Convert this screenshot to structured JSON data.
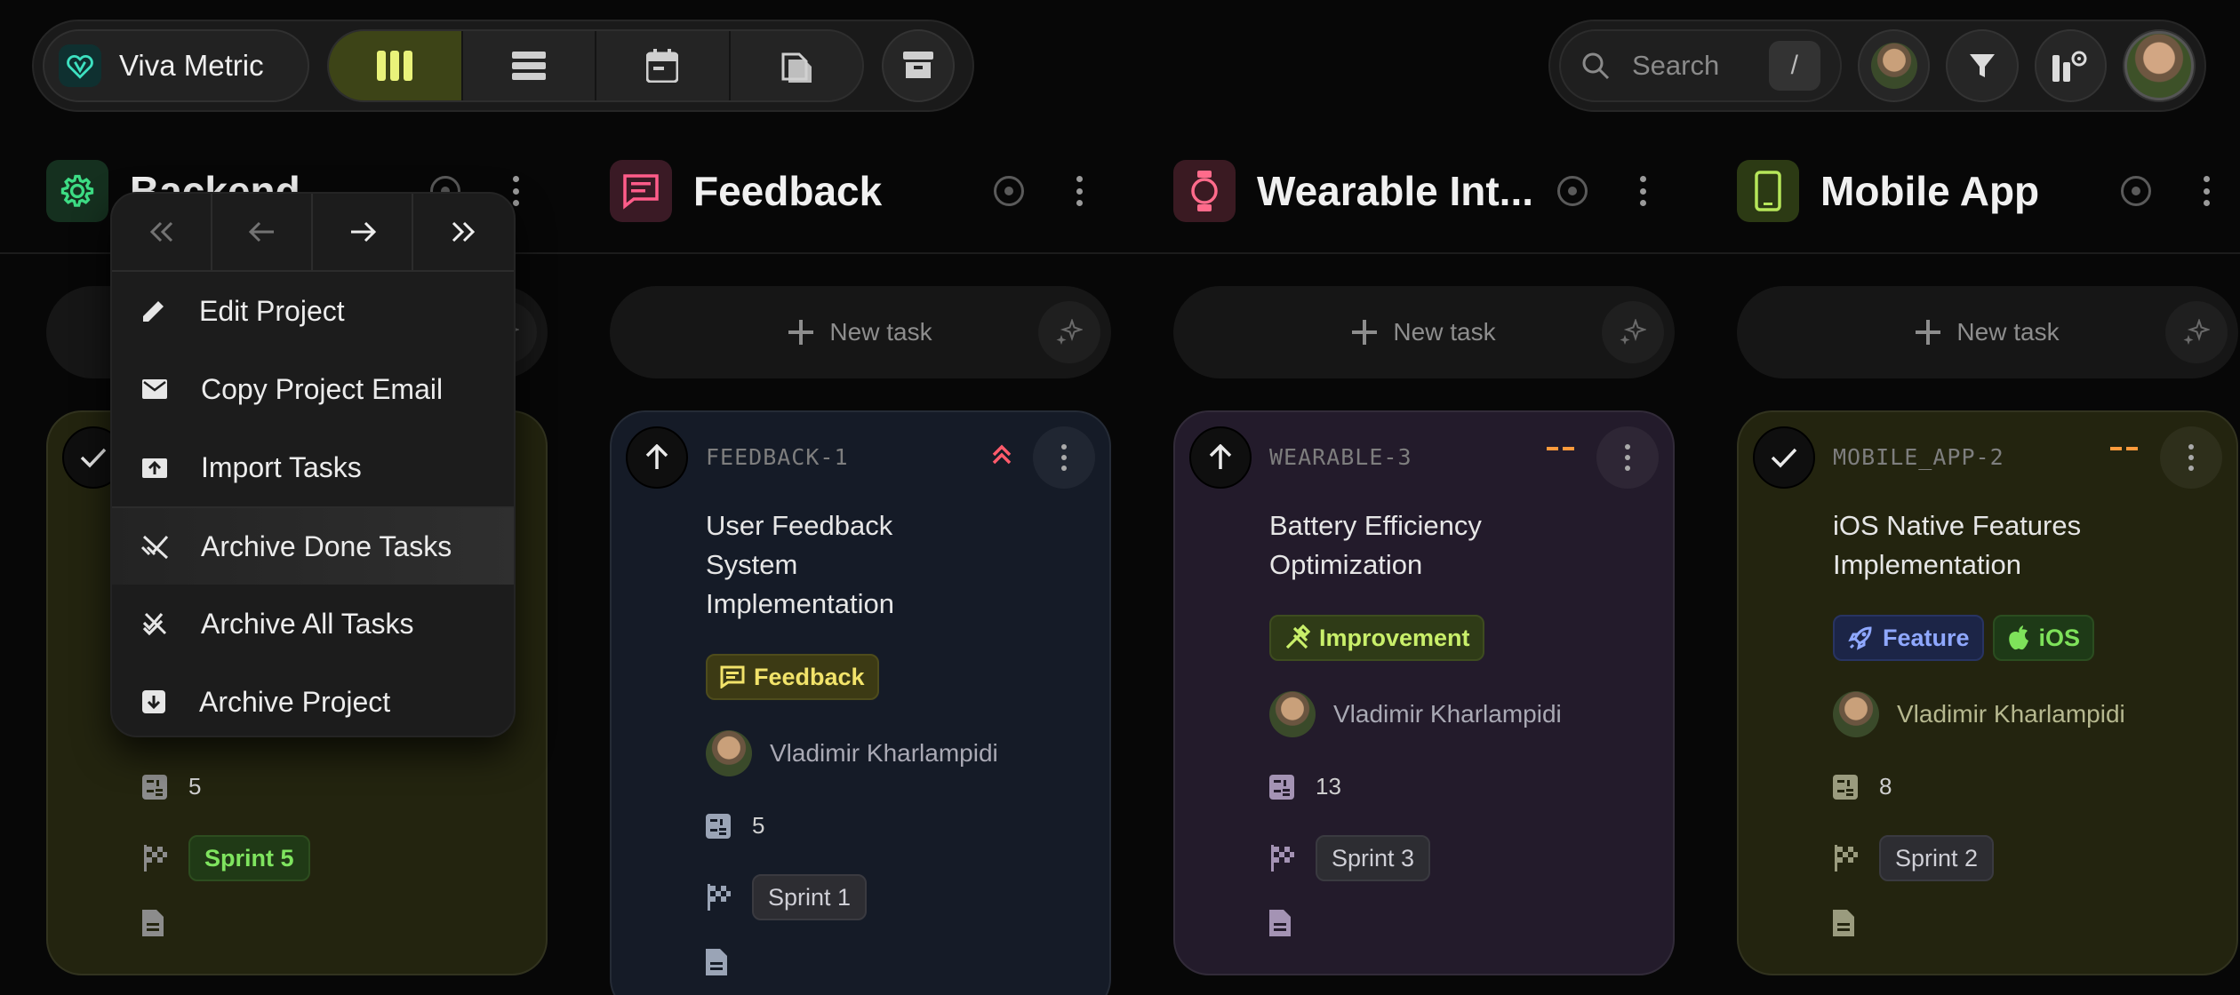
{
  "brand": {
    "name": "Viva Metric"
  },
  "search": {
    "placeholder": "Search",
    "shortcut": "/"
  },
  "columns": [
    {
      "title": "Backend",
      "icon": "gear-icon",
      "accent": "#3ddc84"
    },
    {
      "title": "Feedback",
      "icon": "comment-icon",
      "accent": "#ff5c8a"
    },
    {
      "title": "Wearable Int...",
      "icon": "watch-icon",
      "accent": "#ff6b8b"
    },
    {
      "title": "Mobile App",
      "icon": "smartphone-icon",
      "accent": "#b6e65a"
    }
  ],
  "new_task_label": "New task",
  "cards": [
    {
      "estimate": "5",
      "sprint": "Sprint 5"
    },
    {
      "id": "FEEDBACK-1",
      "title": "User Feedback System Implementation",
      "tags": [
        "Feedback"
      ],
      "assignee": "Vladimir Kharlampidi",
      "estimate": "5",
      "sprint": "Sprint 1"
    },
    {
      "id": "WEARABLE-3",
      "title": "Battery Efficiency Optimization",
      "tags": [
        "Improvement"
      ],
      "assignee": "Vladimir Kharlampidi",
      "estimate": "13",
      "sprint": "Sprint 3"
    },
    {
      "id": "MOBILE_APP-2",
      "title": "iOS Native Features Implementation",
      "tags": [
        "Feature",
        "iOS"
      ],
      "assignee": "Vladimir Kharlampidi",
      "estimate": "8",
      "sprint": "Sprint 2"
    }
  ],
  "menu": {
    "items": [
      {
        "label": "Edit Project",
        "icon": "pencil-icon"
      },
      {
        "label": "Copy Project Email",
        "icon": "mail-icon"
      },
      {
        "label": "Import Tasks",
        "icon": "import-icon"
      },
      {
        "label": "Archive Done Tasks",
        "icon": "archive-done-icon"
      },
      {
        "label": "Archive All Tasks",
        "icon": "archive-all-icon"
      },
      {
        "label": "Archive Project",
        "icon": "archive-box-icon"
      }
    ]
  },
  "colors": {
    "active_view": "#3d4417",
    "accent_yellow": "#e9f27a",
    "priority_high": "#ff5b6b",
    "priority_medium": "#ff9a3c"
  }
}
